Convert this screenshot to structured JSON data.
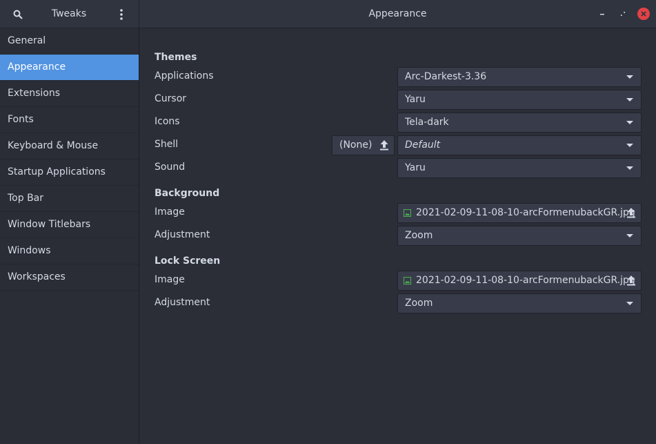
{
  "header": {
    "app_title": "Tweaks",
    "window_title": "Appearance"
  },
  "sidebar": {
    "items": [
      {
        "label": "General"
      },
      {
        "label": "Appearance",
        "selected": true
      },
      {
        "label": "Extensions"
      },
      {
        "label": "Fonts"
      },
      {
        "label": "Keyboard & Mouse"
      },
      {
        "label": "Startup Applications"
      },
      {
        "label": "Top Bar"
      },
      {
        "label": "Window Titlebars"
      },
      {
        "label": "Windows"
      },
      {
        "label": "Workspaces"
      }
    ]
  },
  "themes": {
    "title": "Themes",
    "applications": {
      "label": "Applications",
      "value": "Arc-Darkest-3.36"
    },
    "cursor": {
      "label": "Cursor",
      "value": "Yaru"
    },
    "icons": {
      "label": "Icons",
      "value": "Tela-dark"
    },
    "shell": {
      "label": "Shell",
      "file_value": "(None)",
      "value": "Default"
    },
    "sound": {
      "label": "Sound",
      "value": "Yaru"
    }
  },
  "background": {
    "title": "Background",
    "image": {
      "label": "Image",
      "value": "2021-02-09-11-08-10-arcFormenubackGR.jpg"
    },
    "adjustment": {
      "label": "Adjustment",
      "value": "Zoom"
    }
  },
  "lock_screen": {
    "title": "Lock Screen",
    "image": {
      "label": "Image",
      "value": "2021-02-09-11-08-10-arcFormenubackGR.jpg"
    },
    "adjustment": {
      "label": "Adjustment",
      "value": "Zoom"
    }
  },
  "colors": {
    "accent": "#5294e2",
    "close": "#e14245",
    "image_icon": "#4caf50"
  },
  "icons": {
    "search": "search-icon",
    "menu": "vertical-dots-icon",
    "minimize": "minimize-icon",
    "maximize": "maximize-icon",
    "close": "close-icon",
    "image": "image-file-icon",
    "upload": "upload-icon",
    "dropdown": "dropdown-arrow-icon"
  }
}
